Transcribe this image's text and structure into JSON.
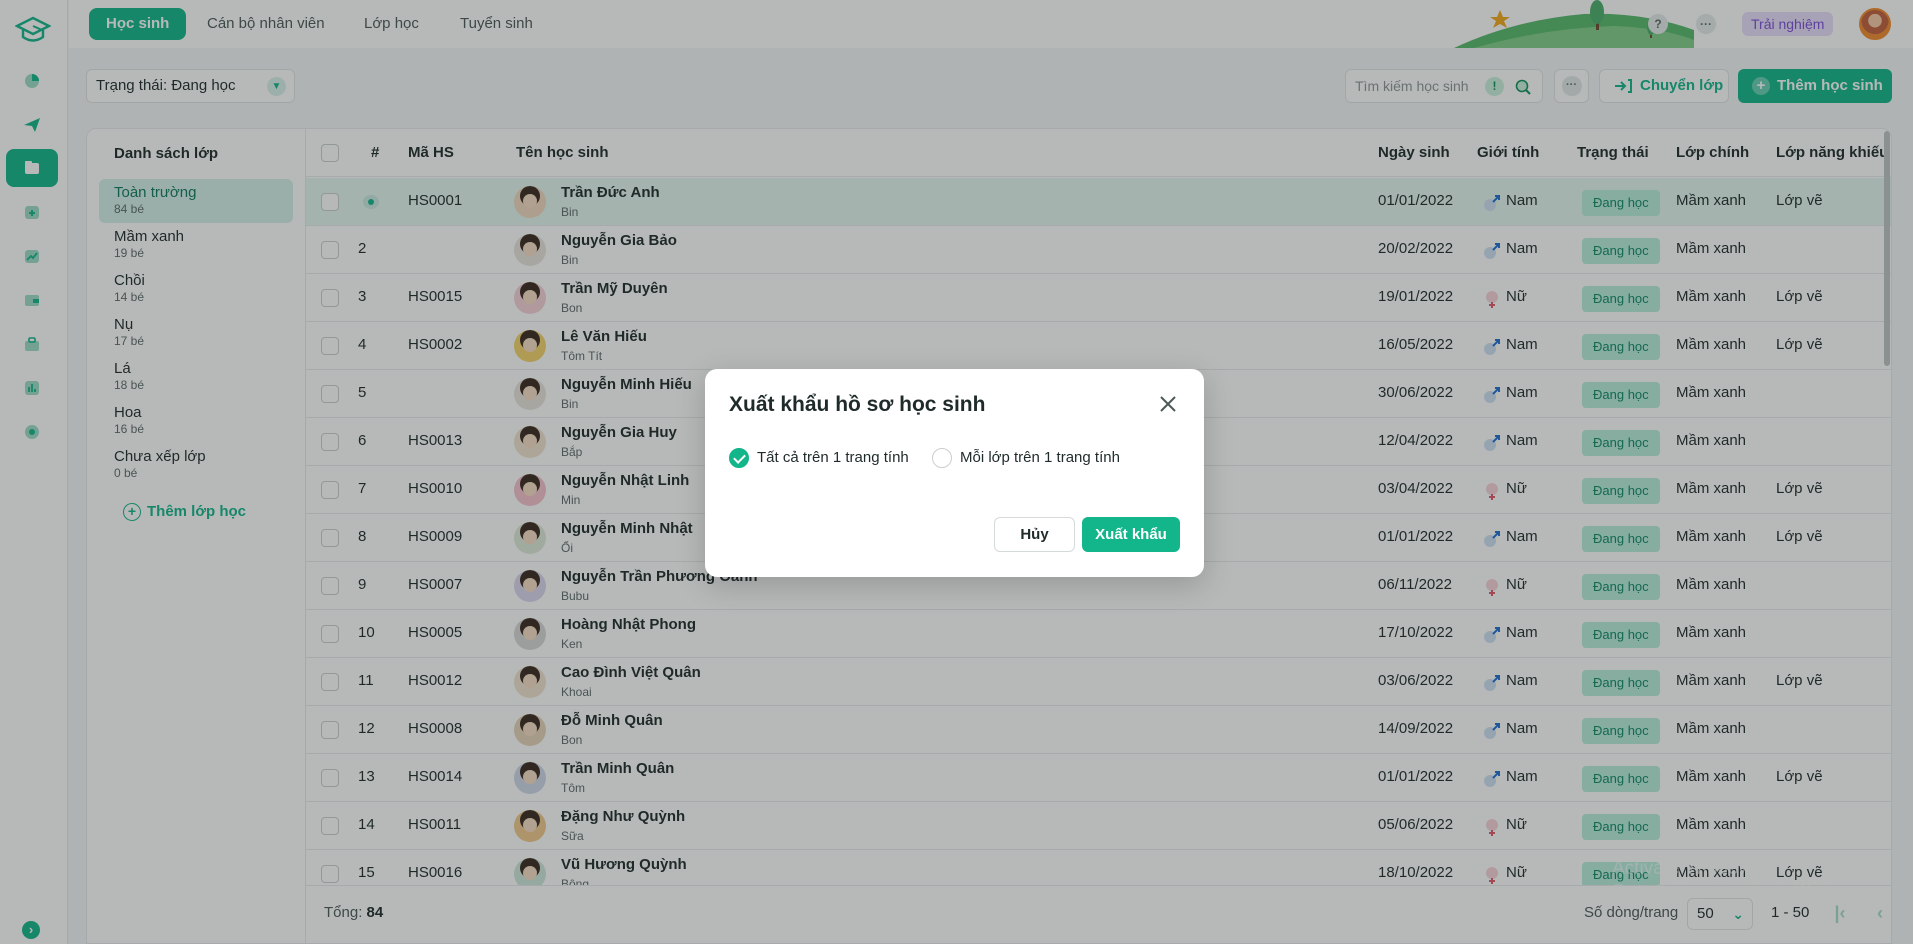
{
  "topbar": {
    "tabs": [
      {
        "label": "Học sinh",
        "active": true
      },
      {
        "label": "Cán bộ nhân viên",
        "active": false
      },
      {
        "label": "Lớp học",
        "active": false
      },
      {
        "label": "Tuyển sinh",
        "active": false
      }
    ],
    "help_icon": "?",
    "more_icon": "···",
    "trial_label": "Trải nghiệm"
  },
  "rail": {
    "icons": [
      "logo-icon",
      "dashboard-icon",
      "send-icon",
      "folder-icon",
      "health-icon",
      "chart-icon",
      "wallet-icon",
      "briefcase-icon",
      "report-icon",
      "settings-icon"
    ],
    "active_index": 3,
    "expand_icon": "›"
  },
  "filters": {
    "status_label": "Trạng thái: Đang học",
    "search_placeholder": "Tìm kiếm học sinh",
    "transfer_label": "Chuyển lớp",
    "add_student_label": "Thêm học sinh"
  },
  "classes": {
    "title": "Danh sách lớp",
    "items": [
      {
        "name": "Toàn trường",
        "count": "84 bé",
        "active": true
      },
      {
        "name": "Mầm xanh",
        "count": "19 bé",
        "active": false
      },
      {
        "name": "Chồi",
        "count": "14 bé",
        "active": false
      },
      {
        "name": "Nụ",
        "count": "17 bé",
        "active": false
      },
      {
        "name": "Lá",
        "count": "18 bé",
        "active": false
      },
      {
        "name": "Hoa",
        "count": "16 bé",
        "active": false
      },
      {
        "name": "Chưa xếp lớp",
        "count": "0 bé",
        "active": false
      }
    ],
    "add_label": "Thêm lớp học"
  },
  "table": {
    "columns": [
      "#",
      "Mã HS",
      "Tên học sinh",
      "Ngày sinh",
      "Giới tính",
      "Trạng thái",
      "Lớp chính",
      "Lớp năng khiếu"
    ],
    "rows": [
      {
        "no": "",
        "code": "HS0001",
        "name": "Trần Đức Anh",
        "nick": "Bin",
        "dob": "01/01/2022",
        "gender": "Nam",
        "status": "Đang học",
        "main": "Mầm xanh",
        "talent": "Lớp vẽ"
      },
      {
        "no": "2",
        "code": "",
        "name": "Nguyễn Gia Bảo",
        "nick": "Bin",
        "dob": "20/02/2022",
        "gender": "Nam",
        "status": "Đang học",
        "main": "Mầm xanh",
        "talent": ""
      },
      {
        "no": "3",
        "code": "HS0015",
        "name": "Trần Mỹ Duyên",
        "nick": "Bon",
        "dob": "19/01/2022",
        "gender": "Nữ",
        "status": "Đang học",
        "main": "Mầm xanh",
        "talent": "Lớp vẽ"
      },
      {
        "no": "4",
        "code": "HS0002",
        "name": "Lê Văn Hiếu",
        "nick": "Tôm Tít",
        "dob": "16/05/2022",
        "gender": "Nam",
        "status": "Đang học",
        "main": "Mầm xanh",
        "talent": "Lớp vẽ"
      },
      {
        "no": "5",
        "code": "",
        "name": "Nguyễn Minh Hiếu",
        "nick": "Bin",
        "dob": "30/06/2022",
        "gender": "Nam",
        "status": "Đang học",
        "main": "Mầm xanh",
        "talent": ""
      },
      {
        "no": "6",
        "code": "HS0013",
        "name": "Nguyễn Gia Huy",
        "nick": "Bắp",
        "dob": "12/04/2022",
        "gender": "Nam",
        "status": "Đang học",
        "main": "Mầm xanh",
        "talent": ""
      },
      {
        "no": "7",
        "code": "HS0010",
        "name": "Nguyễn Nhật Linh",
        "nick": "Min",
        "dob": "03/04/2022",
        "gender": "Nữ",
        "status": "Đang học",
        "main": "Mầm xanh",
        "talent": "Lớp vẽ"
      },
      {
        "no": "8",
        "code": "HS0009",
        "name": "Nguyễn Minh Nhật",
        "nick": "Ổi",
        "dob": "01/01/2022",
        "gender": "Nam",
        "status": "Đang học",
        "main": "Mầm xanh",
        "talent": "Lớp vẽ"
      },
      {
        "no": "9",
        "code": "HS0007",
        "name": "Nguyễn Trần Phương Oanh",
        "nick": "Bubu",
        "dob": "06/11/2022",
        "gender": "Nữ",
        "status": "Đang học",
        "main": "Mầm xanh",
        "talent": ""
      },
      {
        "no": "10",
        "code": "HS0005",
        "name": "Hoàng Nhật Phong",
        "nick": "Ken",
        "dob": "17/10/2022",
        "gender": "Nam",
        "status": "Đang học",
        "main": "Mầm xanh",
        "talent": ""
      },
      {
        "no": "11",
        "code": "HS0012",
        "name": "Cao Đình Việt Quân",
        "nick": "Khoai",
        "dob": "03/06/2022",
        "gender": "Nam",
        "status": "Đang học",
        "main": "Mầm xanh",
        "talent": "Lớp vẽ"
      },
      {
        "no": "12",
        "code": "HS0008",
        "name": "Đỗ Minh Quân",
        "nick": "Bon",
        "dob": "14/09/2022",
        "gender": "Nam",
        "status": "Đang học",
        "main": "Mầm xanh",
        "talent": ""
      },
      {
        "no": "13",
        "code": "HS0014",
        "name": "Trần Minh Quân",
        "nick": "Tôm",
        "dob": "01/01/2022",
        "gender": "Nam",
        "status": "Đang học",
        "main": "Mầm xanh",
        "talent": "Lớp vẽ"
      },
      {
        "no": "14",
        "code": "HS0011",
        "name": "Đặng Như Quỳnh",
        "nick": "Sữa",
        "dob": "05/06/2022",
        "gender": "Nữ",
        "status": "Đang học",
        "main": "Mầm xanh",
        "talent": ""
      },
      {
        "no": "15",
        "code": "HS0016",
        "name": "Vũ Hương Quỳnh",
        "nick": "Bông",
        "dob": "18/10/2022",
        "gender": "Nữ",
        "status": "Đang học",
        "main": "Mầm xanh",
        "talent": "Lớp vẽ"
      }
    ]
  },
  "footer": {
    "total_label": "Tổng:",
    "total_value": "84",
    "rows_per_page_label": "Số dòng/trang",
    "rows_per_page_value": "50",
    "range": "1 - 50"
  },
  "watermark": {
    "line1": "Activate Windows",
    "line2": "Go to Settings to activate Windows."
  },
  "modal": {
    "title": "Xuất khẩu hồ sơ học sinh",
    "option_all": "Tất cả trên 1 trang tính",
    "option_each": "Mỗi lớp trên 1 trang tính",
    "selected": "all",
    "cancel_label": "Hủy",
    "export_label": "Xuất khẩu"
  },
  "colors": {
    "accent": "#13b58a",
    "male": "#1f6fd1",
    "female": "#e05a6e"
  }
}
